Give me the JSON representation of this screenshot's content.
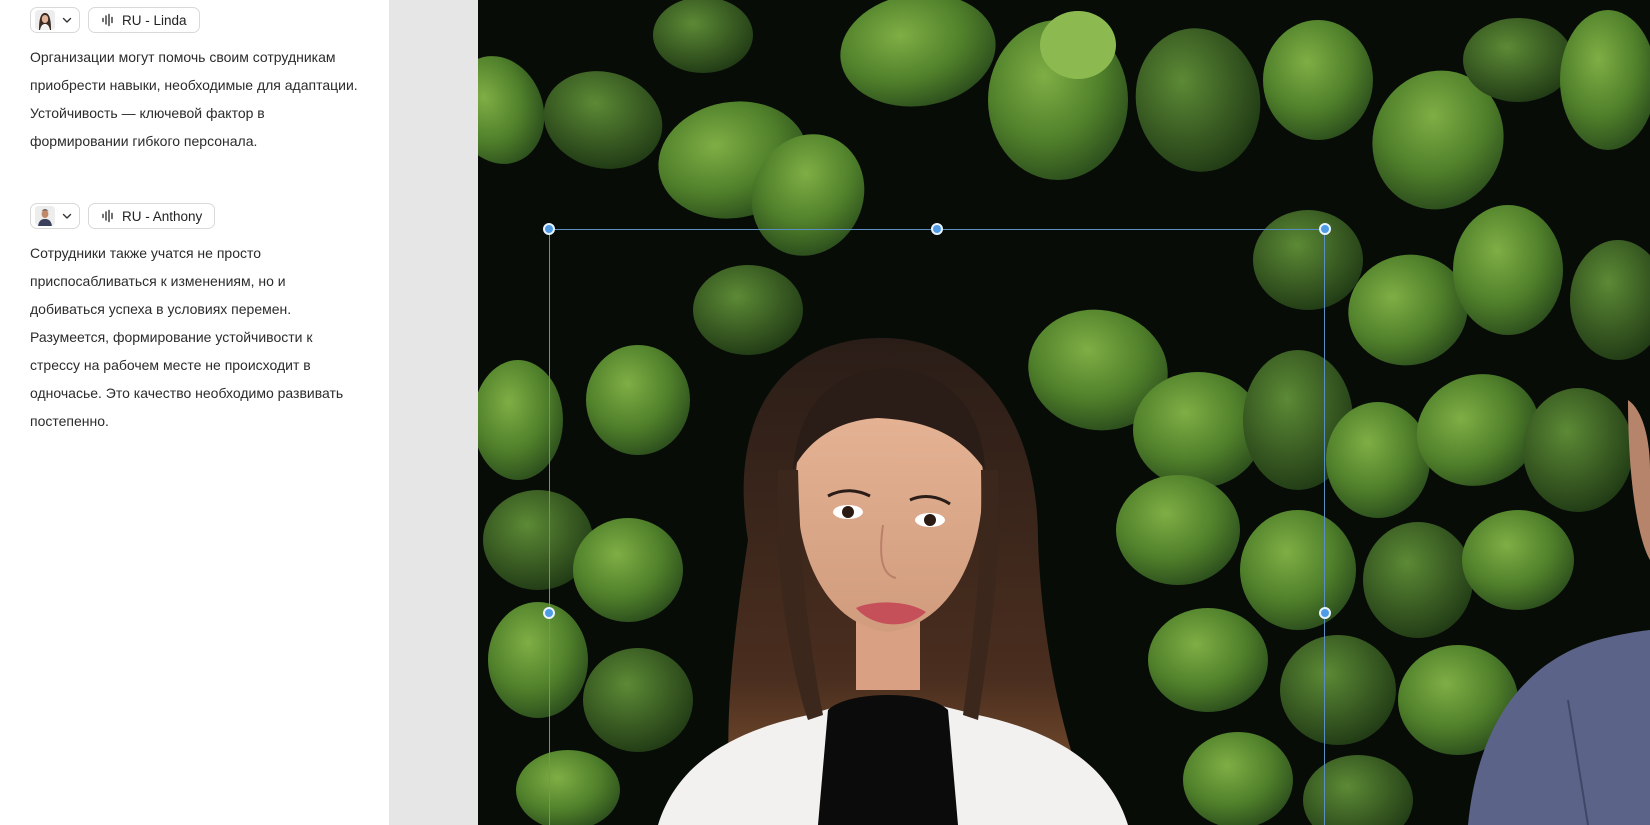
{
  "script_blocks": [
    {
      "avatar": "presenter-linda",
      "voice_label": "RU - Linda",
      "text": "Организации могут помочь своим сотрудникам приобрести навыки, необходимые для адаптации. Устойчивость — ключевой фактор в формировании гибкого персонала."
    },
    {
      "avatar": "presenter-anthony",
      "voice_label": "RU - Anthony",
      "text": "Сотрудники также учатся не просто приспосабливаться к изменениям, но и добиваться успеха в условиях перемен. Разумеется, формирование устойчивости к стрессу на рабочем месте не происходит в одночасье. Это качество необходимо развивать постепенно."
    }
  ],
  "icons": {
    "dropdown": "chevron-down-icon",
    "voice": "audio-waveform-icon"
  },
  "colors": {
    "selection": "#4f9be6",
    "background_leaf": "#3f6b22",
    "panel_border": "#e4e4e4",
    "gutter": "#e6e6e6"
  }
}
